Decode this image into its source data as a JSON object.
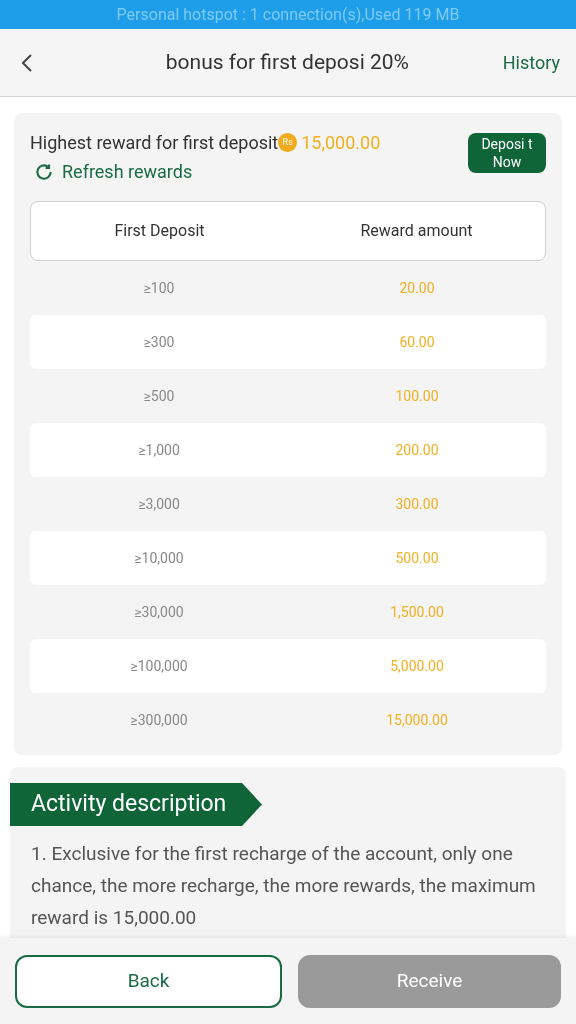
{
  "status_bar": {
    "text": "Personal hotspot : 1 connection(s),Used  119 MB"
  },
  "header": {
    "title": "bonus for first deposi 20%",
    "action": "History"
  },
  "summary": {
    "label": "Highest reward for first deposit",
    "currency": "Rs",
    "amount": "15,000.00",
    "refresh": "Refresh rewards",
    "deposit_button": "Deposi t Now"
  },
  "table": {
    "columns": [
      "First Deposit",
      "Reward amount"
    ],
    "rows": [
      [
        "≥100",
        "20.00"
      ],
      [
        "≥300",
        "60.00"
      ],
      [
        "≥500",
        "100.00"
      ],
      [
        "≥1,000",
        "200.00"
      ],
      [
        "≥3,000",
        "300.00"
      ],
      [
        "≥10,000",
        "500.00"
      ],
      [
        "≥30,000",
        "1,500.00"
      ],
      [
        "≥100,000",
        "5,000.00"
      ],
      [
        "≥300,000",
        "15,000.00"
      ]
    ]
  },
  "description": {
    "title": "Activity description",
    "text": "1. Exclusive for the first recharge of the account, only one chance, the more recharge, the more rewards, the maximum reward is 15,000.00"
  },
  "footer": {
    "back": "Back",
    "receive": "Receive",
    "receive_disabled": true
  }
}
